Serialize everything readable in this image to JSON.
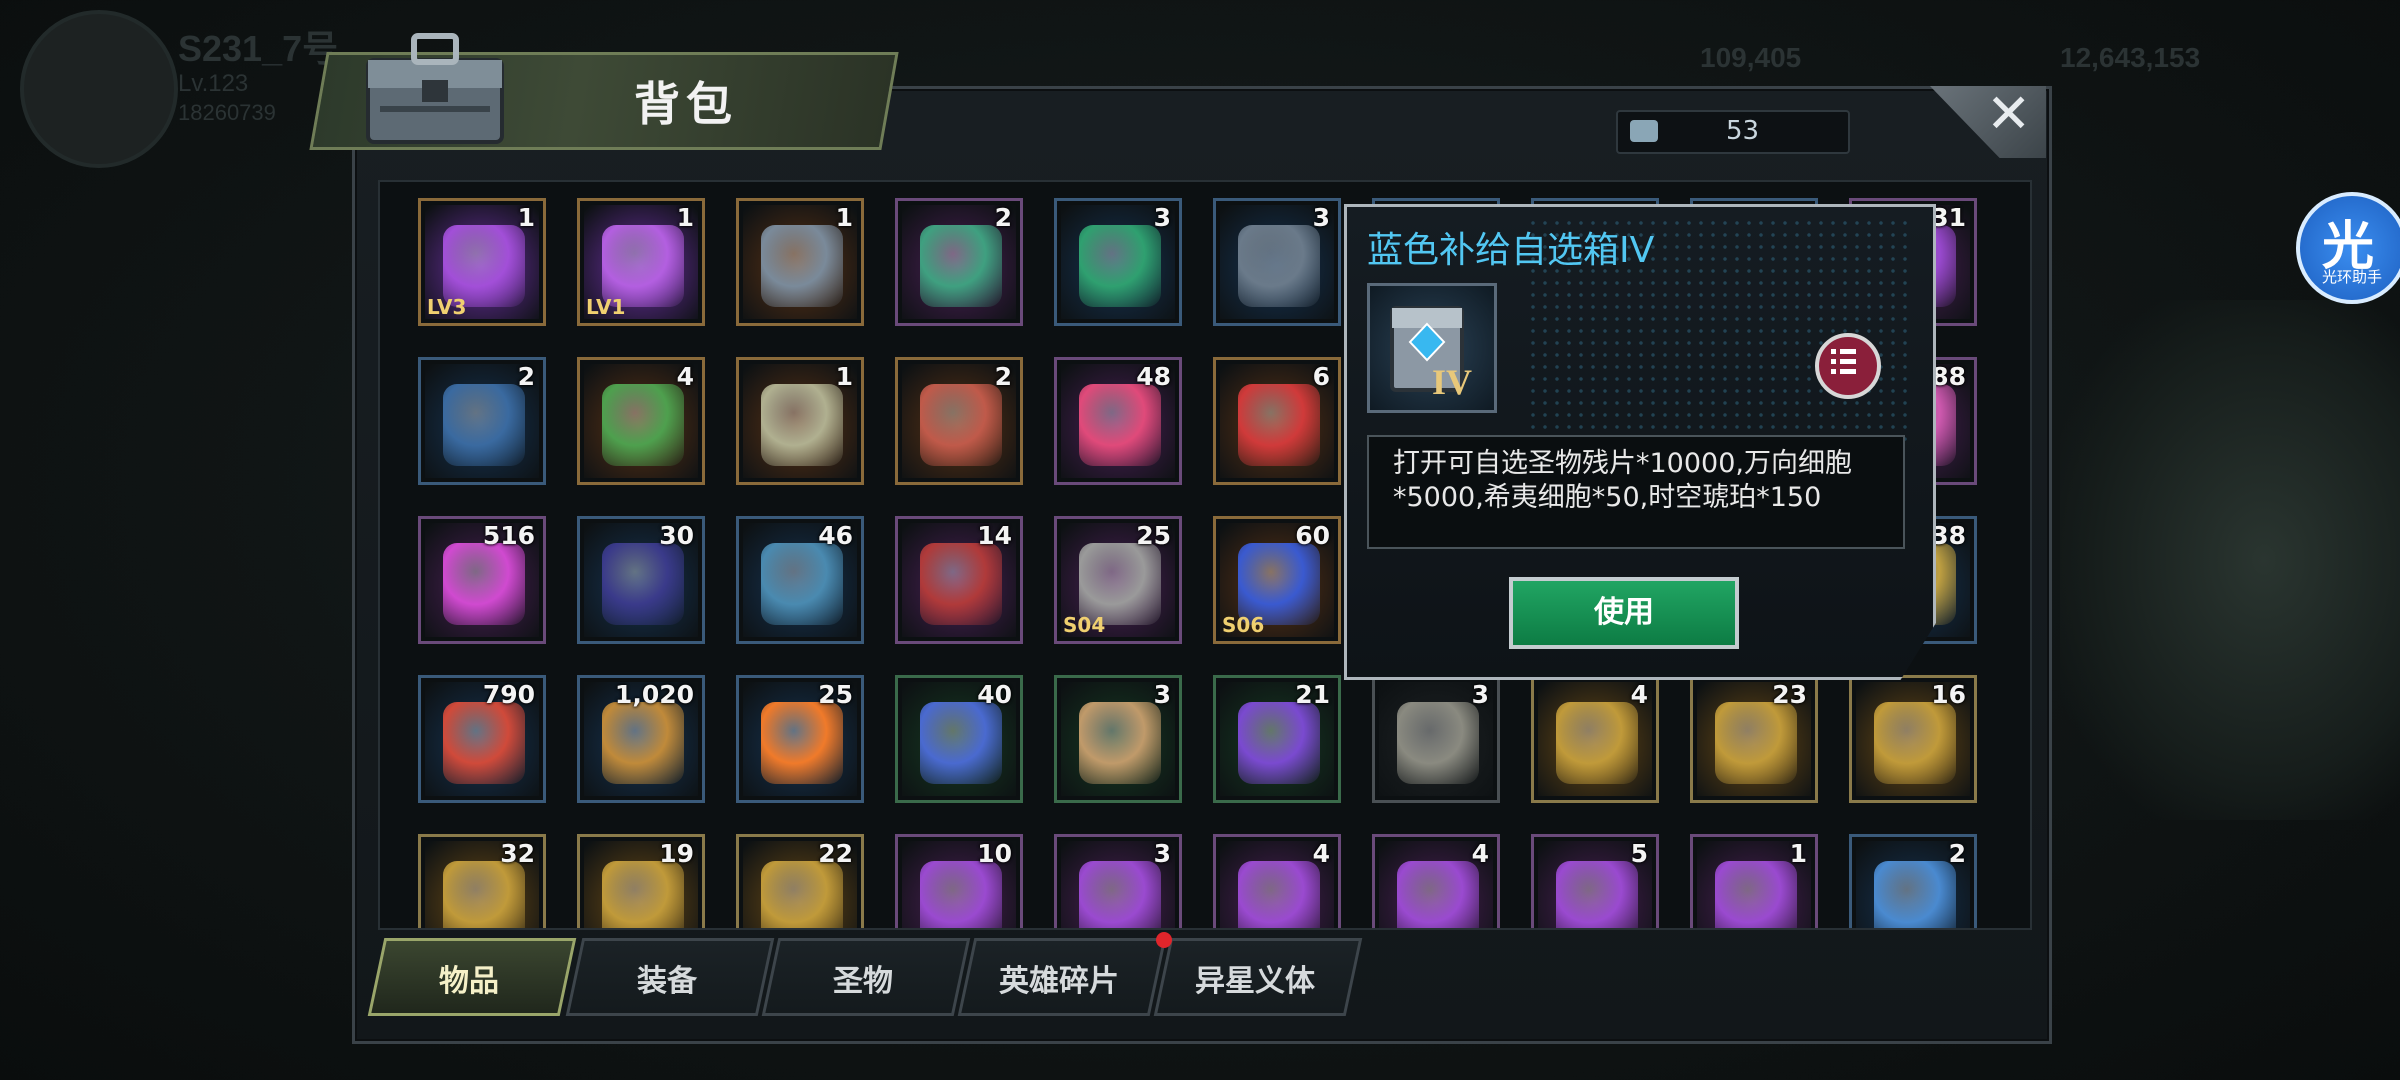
{
  "background": {
    "player_name": "S231_7号",
    "player_level": "Lv.123",
    "player_number": "18260739",
    "resource_1": "109,405",
    "resource_2": "12,643,153"
  },
  "header": {
    "title": "背包",
    "capacity": "53"
  },
  "items": [
    {
      "qty": "1",
      "color": "#6a2fa0",
      "frame": "#8a6a3a",
      "art": "#a24fd8",
      "tag": "LV3"
    },
    {
      "qty": "1",
      "color": "#6a2fa0",
      "frame": "#8a6a3a",
      "art": "#b35fe0",
      "tag": "LV1"
    },
    {
      "qty": "1",
      "color": "#5a3216",
      "frame": "#8a6a3a",
      "art": "#7a8a9a",
      "tag": ""
    },
    {
      "qty": "2",
      "color": "#4a1f55",
      "frame": "#6a4a7a",
      "art": "#3fa080",
      "tag": ""
    },
    {
      "qty": "3",
      "color": "#163352",
      "frame": "#3a5a7a",
      "art": "#2fa070",
      "tag": ""
    },
    {
      "qty": "3",
      "color": "#163352",
      "frame": "#3a5a7a",
      "art": "#6a7a8a",
      "tag": ""
    },
    {
      "qty": "",
      "color": "#163352",
      "frame": "#3a5a7a",
      "art": "#163352",
      "tag": ""
    },
    {
      "qty": "",
      "color": "#163352",
      "frame": "#3a5a7a",
      "art": "#163352",
      "tag": ""
    },
    {
      "qty": "",
      "color": "#163352",
      "frame": "#3a5a7a",
      "art": "#163352",
      "tag": ""
    },
    {
      "qty": "31",
      "color": "#4a1f55",
      "frame": "#6a4a7a",
      "art": "#9a4ad0",
      "tag": ""
    },
    {
      "qty": "2",
      "color": "#163352",
      "frame": "#3a5a7a",
      "art": "#3a6aa0",
      "tag": ""
    },
    {
      "qty": "4",
      "color": "#5a3216",
      "frame": "#8a6a3a",
      "art": "#4ea04e",
      "tag": ""
    },
    {
      "qty": "1",
      "color": "#5a3216",
      "frame": "#8a6a3a",
      "art": "#b0b090",
      "tag": ""
    },
    {
      "qty": "2",
      "color": "#5a3216",
      "frame": "#8a6a3a",
      "art": "#c05a4a",
      "tag": ""
    },
    {
      "qty": "48",
      "color": "#4a1f55",
      "frame": "#6a4a7a",
      "art": "#e04a7a",
      "tag": ""
    },
    {
      "qty": "6",
      "color": "#5a3216",
      "frame": "#8a6a3a",
      "art": "#d03a3a",
      "tag": ""
    },
    {
      "qty": "",
      "color": "#163352",
      "frame": "#3a5a7a",
      "art": "#163352",
      "tag": ""
    },
    {
      "qty": "",
      "color": "#163352",
      "frame": "#3a5a7a",
      "art": "#163352",
      "tag": ""
    },
    {
      "qty": "",
      "color": "#163352",
      "frame": "#3a5a7a",
      "art": "#163352",
      "tag": ""
    },
    {
      "qty": "88",
      "color": "#4a1f55",
      "frame": "#6a4a7a",
      "art": "#d05ab0",
      "tag": ""
    },
    {
      "qty": "516",
      "color": "#4a1f55",
      "frame": "#6a4a7a",
      "art": "#d04ad0",
      "tag": ""
    },
    {
      "qty": "30",
      "color": "#163352",
      "frame": "#3a5a7a",
      "art": "#3a3a8a",
      "tag": ""
    },
    {
      "qty": "46",
      "color": "#163352",
      "frame": "#3a5a7a",
      "art": "#4a8ab0",
      "tag": ""
    },
    {
      "qty": "14",
      "color": "#4a1f55",
      "frame": "#6a4a7a",
      "art": "#b03a3a",
      "tag": ""
    },
    {
      "qty": "25",
      "color": "#4a1f55",
      "frame": "#6a4a7a",
      "art": "#9a9a9a",
      "tag": "S04"
    },
    {
      "qty": "60",
      "color": "#5a3216",
      "frame": "#8a6a3a",
      "art": "#3a5ad0",
      "tag": "S06"
    },
    {
      "qty": "",
      "color": "#163352",
      "frame": "#3a5a7a",
      "art": "#163352",
      "tag": ""
    },
    {
      "qty": "",
      "color": "#163352",
      "frame": "#3a5a7a",
      "art": "#163352",
      "tag": ""
    },
    {
      "qty": "",
      "color": "#163352",
      "frame": "#3a5a7a",
      "art": "#163352",
      "tag": ""
    },
    {
      "qty": "38",
      "color": "#163352",
      "frame": "#3a5a7a",
      "art": "#c0a040",
      "tag": ""
    },
    {
      "qty": "790",
      "color": "#163352",
      "frame": "#3a5a7a",
      "art": "#d04a3a",
      "tag": ""
    },
    {
      "qty": "1,020",
      "color": "#163352",
      "frame": "#3a5a7a",
      "art": "#c08a3a",
      "tag": ""
    },
    {
      "qty": "25",
      "color": "#163352",
      "frame": "#3a5a7a",
      "art": "#f07a2a",
      "tag": ""
    },
    {
      "qty": "40",
      "color": "#163a22",
      "frame": "#3a6a4a",
      "art": "#4a6ad0",
      "tag": ""
    },
    {
      "qty": "3",
      "color": "#163a22",
      "frame": "#3a6a4a",
      "art": "#c09a6a",
      "tag": ""
    },
    {
      "qty": "21",
      "color": "#163a22",
      "frame": "#3a6a4a",
      "art": "#7a4ad0",
      "tag": ""
    },
    {
      "qty": "3",
      "color": "#1e2224",
      "frame": "#4a5054",
      "art": "#8a8a80",
      "tag": ""
    },
    {
      "qty": "4",
      "color": "#6a4a16",
      "frame": "#8a7a4a",
      "art": "#c09a3a",
      "tag": ""
    },
    {
      "qty": "23",
      "color": "#6a4a16",
      "frame": "#8a7a4a",
      "art": "#c09a3a",
      "tag": ""
    },
    {
      "qty": "16",
      "color": "#6a4a16",
      "frame": "#8a7a4a",
      "art": "#c09a3a",
      "tag": ""
    },
    {
      "qty": "32",
      "color": "#6a4a16",
      "frame": "#8a7a4a",
      "art": "#c09a3a",
      "tag": ""
    },
    {
      "qty": "19",
      "color": "#6a4a16",
      "frame": "#8a7a4a",
      "art": "#c09a3a",
      "tag": ""
    },
    {
      "qty": "22",
      "color": "#6a4a16",
      "frame": "#8a7a4a",
      "art": "#c09a3a",
      "tag": ""
    },
    {
      "qty": "10",
      "color": "#4a1f55",
      "frame": "#6a4a7a",
      "art": "#9a4ad0",
      "tag": ""
    },
    {
      "qty": "3",
      "color": "#4a1f55",
      "frame": "#6a4a7a",
      "art": "#9a4ad0",
      "tag": ""
    },
    {
      "qty": "4",
      "color": "#4a1f55",
      "frame": "#6a4a7a",
      "art": "#9a4ad0",
      "tag": ""
    },
    {
      "qty": "4",
      "color": "#4a1f55",
      "frame": "#6a4a7a",
      "art": "#9a4ad0",
      "tag": ""
    },
    {
      "qty": "5",
      "color": "#4a1f55",
      "frame": "#6a4a7a",
      "art": "#9a4ad0",
      "tag": ""
    },
    {
      "qty": "1",
      "color": "#4a1f55",
      "frame": "#6a4a7a",
      "art": "#9a4ad0",
      "tag": ""
    },
    {
      "qty": "2",
      "color": "#163352",
      "frame": "#3a5a7a",
      "art": "#4a8ad0",
      "tag": ""
    }
  ],
  "popup": {
    "title": "蓝色补给自选箱IV",
    "description": "打开可自选圣物残片*10000,万向细胞*5000,希夷细胞*50,时空琥珀*150",
    "use_label": "使用",
    "list_icon": "list-icon"
  },
  "tabs": [
    {
      "label": "物品",
      "active": true
    },
    {
      "label": "装备",
      "active": false
    },
    {
      "label": "圣物",
      "active": false
    },
    {
      "label": "英雄碎片",
      "active": false,
      "badge": true
    },
    {
      "label": "异星义体",
      "active": false
    }
  ],
  "assistant": {
    "glyph": "光",
    "label": "光环助手"
  }
}
